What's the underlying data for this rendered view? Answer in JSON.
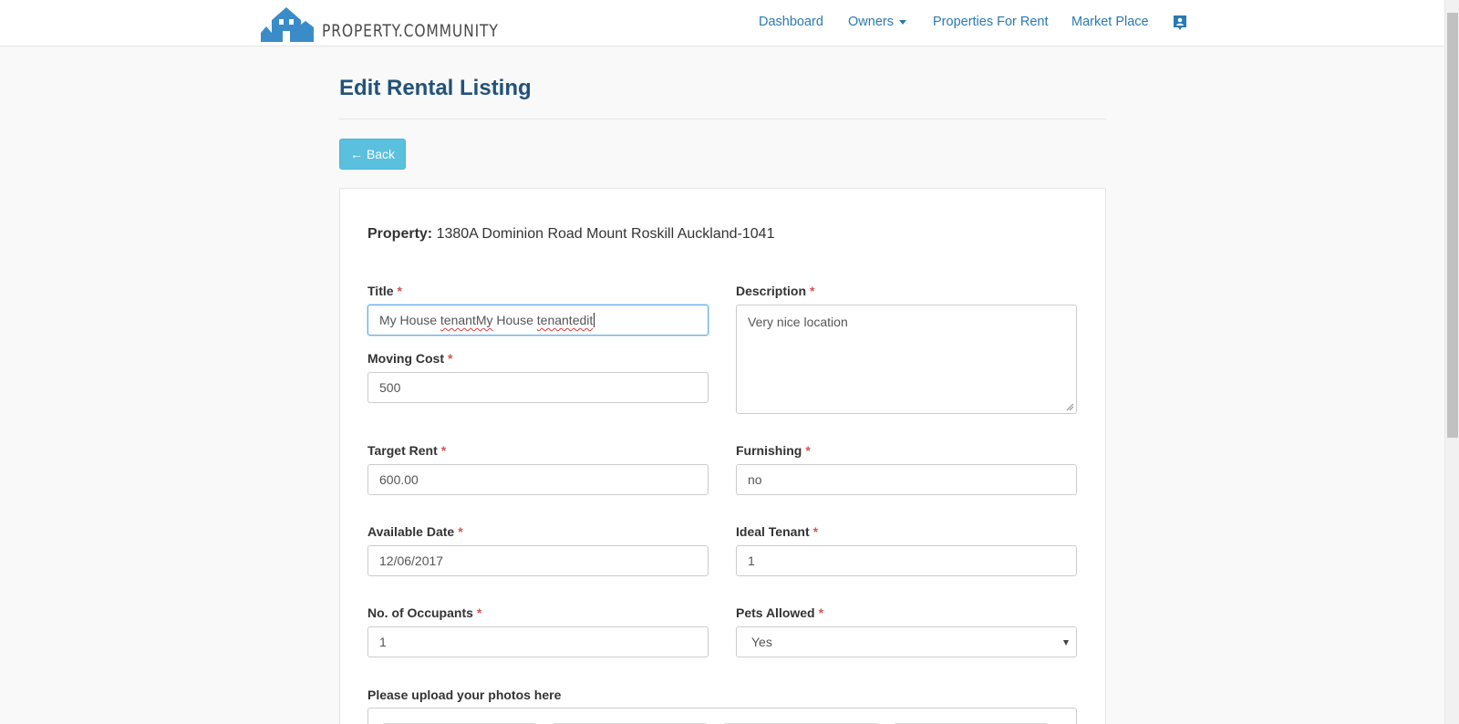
{
  "nav": {
    "brand": "PROPERTY.COMMUNITY",
    "items": [
      "Dashboard",
      "Owners",
      "Properties For Rent",
      "Market Place"
    ],
    "profile_icon": "contact-card-icon"
  },
  "page": {
    "title": "Edit Rental Listing",
    "back_label": "Back",
    "back_icon": "arrow-left-icon"
  },
  "property": {
    "label": "Property:",
    "address": "1380A Dominion Road Mount Roskill Auckland-1041"
  },
  "form": {
    "required_marker": "*",
    "title": {
      "label": "Title",
      "value_parts": [
        "My House ",
        "tenantMy",
        " House ",
        "tenantedit"
      ]
    },
    "description": {
      "label": "Description",
      "value": "Very nice location"
    },
    "moving_cost": {
      "label": "Moving Cost",
      "value": "500"
    },
    "target_rent": {
      "label": "Target Rent",
      "value": "600.00"
    },
    "furnishing": {
      "label": "Furnishing",
      "value": "no"
    },
    "available_date": {
      "label": "Available Date",
      "value": "12/06/2017"
    },
    "ideal_tenant": {
      "label": "Ideal Tenant",
      "value": "1"
    },
    "occupants": {
      "label": "No. of Occupants",
      "value": "1"
    },
    "pets_allowed": {
      "label": "Pets Allowed",
      "value": "Yes"
    },
    "upload_label": "Please upload your photos here"
  },
  "colors": {
    "brand_blue": "#3a8cc8",
    "link": "#2a7ab3",
    "title": "#22527b",
    "info_button": "#5bc0de",
    "required": "#d9534f"
  }
}
